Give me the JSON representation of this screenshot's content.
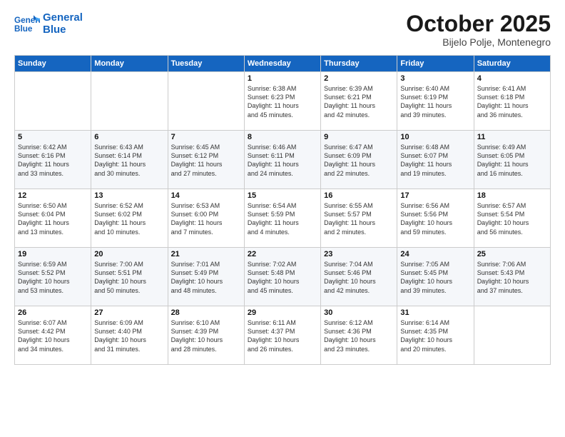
{
  "header": {
    "logo_line1": "General",
    "logo_line2": "Blue",
    "month": "October 2025",
    "location": "Bijelo Polje, Montenegro"
  },
  "days_of_week": [
    "Sunday",
    "Monday",
    "Tuesday",
    "Wednesday",
    "Thursday",
    "Friday",
    "Saturday"
  ],
  "weeks": [
    [
      {
        "day": "",
        "text": ""
      },
      {
        "day": "",
        "text": ""
      },
      {
        "day": "",
        "text": ""
      },
      {
        "day": "1",
        "text": "Sunrise: 6:38 AM\nSunset: 6:23 PM\nDaylight: 11 hours\nand 45 minutes."
      },
      {
        "day": "2",
        "text": "Sunrise: 6:39 AM\nSunset: 6:21 PM\nDaylight: 11 hours\nand 42 minutes."
      },
      {
        "day": "3",
        "text": "Sunrise: 6:40 AM\nSunset: 6:19 PM\nDaylight: 11 hours\nand 39 minutes."
      },
      {
        "day": "4",
        "text": "Sunrise: 6:41 AM\nSunset: 6:18 PM\nDaylight: 11 hours\nand 36 minutes."
      }
    ],
    [
      {
        "day": "5",
        "text": "Sunrise: 6:42 AM\nSunset: 6:16 PM\nDaylight: 11 hours\nand 33 minutes."
      },
      {
        "day": "6",
        "text": "Sunrise: 6:43 AM\nSunset: 6:14 PM\nDaylight: 11 hours\nand 30 minutes."
      },
      {
        "day": "7",
        "text": "Sunrise: 6:45 AM\nSunset: 6:12 PM\nDaylight: 11 hours\nand 27 minutes."
      },
      {
        "day": "8",
        "text": "Sunrise: 6:46 AM\nSunset: 6:11 PM\nDaylight: 11 hours\nand 24 minutes."
      },
      {
        "day": "9",
        "text": "Sunrise: 6:47 AM\nSunset: 6:09 PM\nDaylight: 11 hours\nand 22 minutes."
      },
      {
        "day": "10",
        "text": "Sunrise: 6:48 AM\nSunset: 6:07 PM\nDaylight: 11 hours\nand 19 minutes."
      },
      {
        "day": "11",
        "text": "Sunrise: 6:49 AM\nSunset: 6:05 PM\nDaylight: 11 hours\nand 16 minutes."
      }
    ],
    [
      {
        "day": "12",
        "text": "Sunrise: 6:50 AM\nSunset: 6:04 PM\nDaylight: 11 hours\nand 13 minutes."
      },
      {
        "day": "13",
        "text": "Sunrise: 6:52 AM\nSunset: 6:02 PM\nDaylight: 11 hours\nand 10 minutes."
      },
      {
        "day": "14",
        "text": "Sunrise: 6:53 AM\nSunset: 6:00 PM\nDaylight: 11 hours\nand 7 minutes."
      },
      {
        "day": "15",
        "text": "Sunrise: 6:54 AM\nSunset: 5:59 PM\nDaylight: 11 hours\nand 4 minutes."
      },
      {
        "day": "16",
        "text": "Sunrise: 6:55 AM\nSunset: 5:57 PM\nDaylight: 11 hours\nand 2 minutes."
      },
      {
        "day": "17",
        "text": "Sunrise: 6:56 AM\nSunset: 5:56 PM\nDaylight: 10 hours\nand 59 minutes."
      },
      {
        "day": "18",
        "text": "Sunrise: 6:57 AM\nSunset: 5:54 PM\nDaylight: 10 hours\nand 56 minutes."
      }
    ],
    [
      {
        "day": "19",
        "text": "Sunrise: 6:59 AM\nSunset: 5:52 PM\nDaylight: 10 hours\nand 53 minutes."
      },
      {
        "day": "20",
        "text": "Sunrise: 7:00 AM\nSunset: 5:51 PM\nDaylight: 10 hours\nand 50 minutes."
      },
      {
        "day": "21",
        "text": "Sunrise: 7:01 AM\nSunset: 5:49 PM\nDaylight: 10 hours\nand 48 minutes."
      },
      {
        "day": "22",
        "text": "Sunrise: 7:02 AM\nSunset: 5:48 PM\nDaylight: 10 hours\nand 45 minutes."
      },
      {
        "day": "23",
        "text": "Sunrise: 7:04 AM\nSunset: 5:46 PM\nDaylight: 10 hours\nand 42 minutes."
      },
      {
        "day": "24",
        "text": "Sunrise: 7:05 AM\nSunset: 5:45 PM\nDaylight: 10 hours\nand 39 minutes."
      },
      {
        "day": "25",
        "text": "Sunrise: 7:06 AM\nSunset: 5:43 PM\nDaylight: 10 hours\nand 37 minutes."
      }
    ],
    [
      {
        "day": "26",
        "text": "Sunrise: 6:07 AM\nSunset: 4:42 PM\nDaylight: 10 hours\nand 34 minutes."
      },
      {
        "day": "27",
        "text": "Sunrise: 6:09 AM\nSunset: 4:40 PM\nDaylight: 10 hours\nand 31 minutes."
      },
      {
        "day": "28",
        "text": "Sunrise: 6:10 AM\nSunset: 4:39 PM\nDaylight: 10 hours\nand 28 minutes."
      },
      {
        "day": "29",
        "text": "Sunrise: 6:11 AM\nSunset: 4:37 PM\nDaylight: 10 hours\nand 26 minutes."
      },
      {
        "day": "30",
        "text": "Sunrise: 6:12 AM\nSunset: 4:36 PM\nDaylight: 10 hours\nand 23 minutes."
      },
      {
        "day": "31",
        "text": "Sunrise: 6:14 AM\nSunset: 4:35 PM\nDaylight: 10 hours\nand 20 minutes."
      },
      {
        "day": "",
        "text": ""
      }
    ]
  ]
}
